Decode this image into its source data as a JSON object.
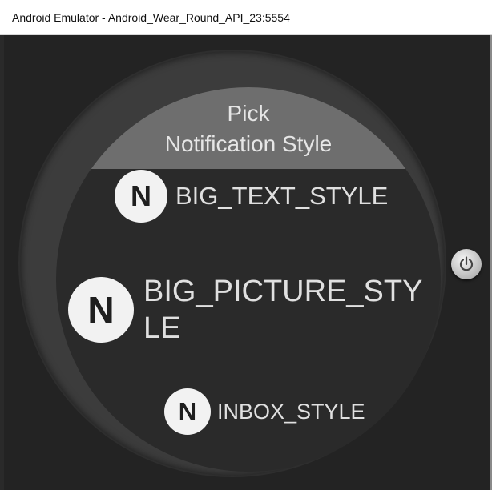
{
  "window": {
    "title": "Android Emulator - Android_Wear_Round_API_23:5554"
  },
  "watch": {
    "header_line1": "Pick",
    "header_line2": "Notification Style",
    "items": [
      {
        "badge": "N",
        "label": "BIG_TEXT_STYLE"
      },
      {
        "badge": "N",
        "label_line1": "BIG_PICTURE_STY",
        "label_line2": "LE"
      },
      {
        "badge": "N",
        "label": "INBOX_STYLE"
      }
    ]
  },
  "controls": {
    "power_icon": "power-icon"
  },
  "colors": {
    "emulator_background": "#232323",
    "bezel": "#3c3c3c",
    "screen": "#2a2a2a",
    "header": "#6e6e6e",
    "badge": "#f2f2f2",
    "text": "#e0e0e0"
  }
}
